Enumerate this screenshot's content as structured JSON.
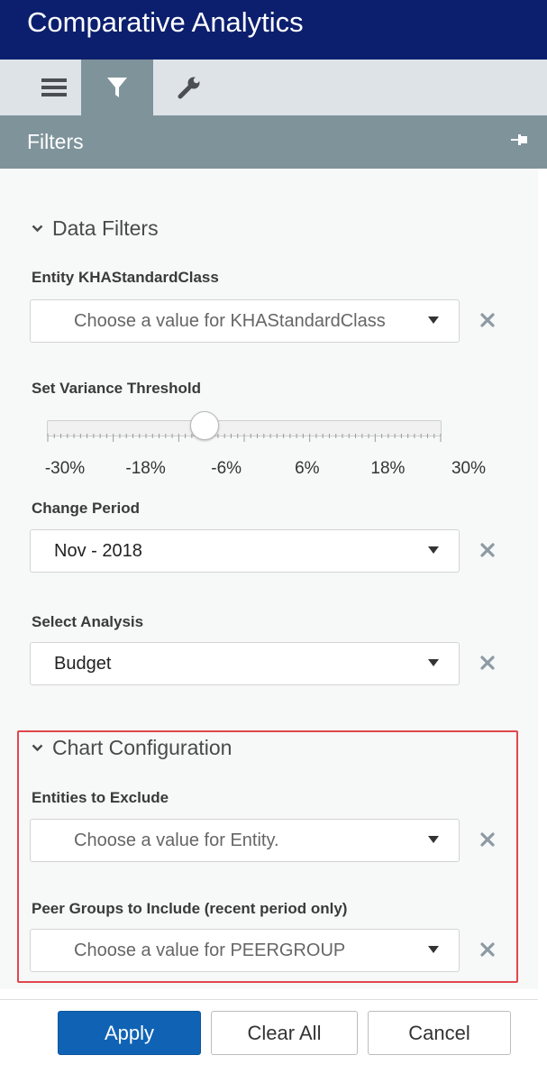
{
  "app": {
    "title": "Comparative Analytics"
  },
  "panel": {
    "title": "Filters"
  },
  "sections": {
    "data_filters": {
      "title": "Data Filters"
    },
    "chart_config": {
      "title": "Chart Configuration"
    }
  },
  "fields": {
    "entity_class": {
      "label": "Entity KHAStandardClass",
      "placeholder": "Choose a value for KHAStandardClass"
    },
    "variance": {
      "label": "Set Variance Threshold",
      "min": -30,
      "max": 30,
      "value": -6,
      "tick_labels": [
        "-30%",
        "-18%",
        "-6%",
        "6%",
        "18%",
        "30%"
      ]
    },
    "change_period": {
      "label": "Change Period",
      "value": "Nov - 2018"
    },
    "analysis": {
      "label": "Select Analysis",
      "value": "Budget"
    },
    "entities_exclude": {
      "label": "Entities to Exclude",
      "placeholder": "Choose a value for Entity."
    },
    "peer_groups": {
      "label": "Peer Groups to Include (recent period only)",
      "placeholder": "Choose a value for PEERGROUP"
    }
  },
  "buttons": {
    "apply": "Apply",
    "clear": "Clear All",
    "cancel": "Cancel"
  },
  "icons": {
    "menu": "hamburger-icon",
    "filter": "funnel-icon",
    "settings": "wrench-icon",
    "pin": "pin-icon",
    "expand": "chevron-down-icon",
    "dropdown": "caret-down-icon",
    "clear": "close-icon"
  },
  "colors": {
    "header_bg": "#0c1f6e",
    "active_tab": "#7f939b",
    "primary_button": "#1063b4",
    "highlight_border": "#e0474c",
    "clear_icon": "#8d9aa3"
  }
}
